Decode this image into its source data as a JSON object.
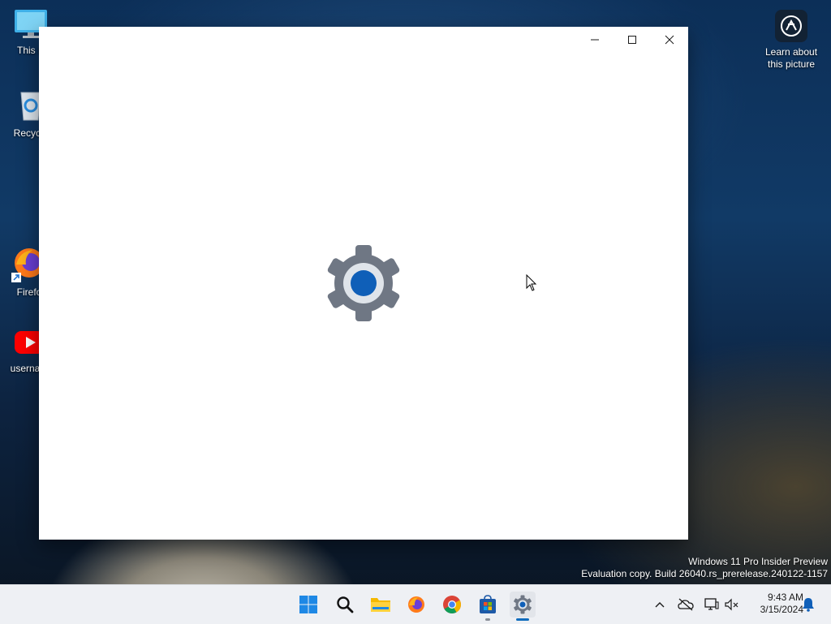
{
  "desktop": {
    "icons": [
      {
        "label": "This P",
        "icon": "monitor-icon"
      },
      {
        "label": "Recycle",
        "icon": "recycle-bin-icon"
      },
      {
        "label": "Firefo",
        "icon": "firefox-icon"
      },
      {
        "label": "usernam",
        "icon": "youtube-icon"
      }
    ],
    "learn_about": {
      "line1": "Learn about",
      "line2": "this picture",
      "icon": "camera-info-icon"
    },
    "watermark": {
      "line1": "Windows 11 Pro Insider Preview",
      "line2": "Evaluation copy. Build 26040.rs_prerelease.240122-1157"
    }
  },
  "window": {
    "app": "Settings",
    "splash_icon": "settings-gear-icon",
    "controls": {
      "minimize": "minimize-icon",
      "maximize": "maximize-icon",
      "close": "close-icon"
    }
  },
  "taskbar": {
    "apps": [
      {
        "name": "start",
        "icon": "windows-start-icon"
      },
      {
        "name": "search",
        "icon": "search-icon"
      },
      {
        "name": "file-explorer",
        "icon": "folder-icon"
      },
      {
        "name": "firefox",
        "icon": "firefox-icon"
      },
      {
        "name": "chrome",
        "icon": "chrome-icon"
      },
      {
        "name": "store",
        "icon": "store-icon"
      },
      {
        "name": "settings",
        "icon": "settings-gear-icon",
        "active": true
      }
    ],
    "tray": {
      "chevron": "chevron-up-icon",
      "icons": [
        "onedrive-off-icon",
        "network-icon",
        "volume-muted-icon"
      ],
      "notification": "bell-icon"
    },
    "clock": {
      "time": "9:43 AM",
      "date": "3/15/2024"
    }
  },
  "colors": {
    "accent": "#0f5fb8",
    "gear": "#6d7582",
    "taskbar_bg": "#eef0f4"
  }
}
